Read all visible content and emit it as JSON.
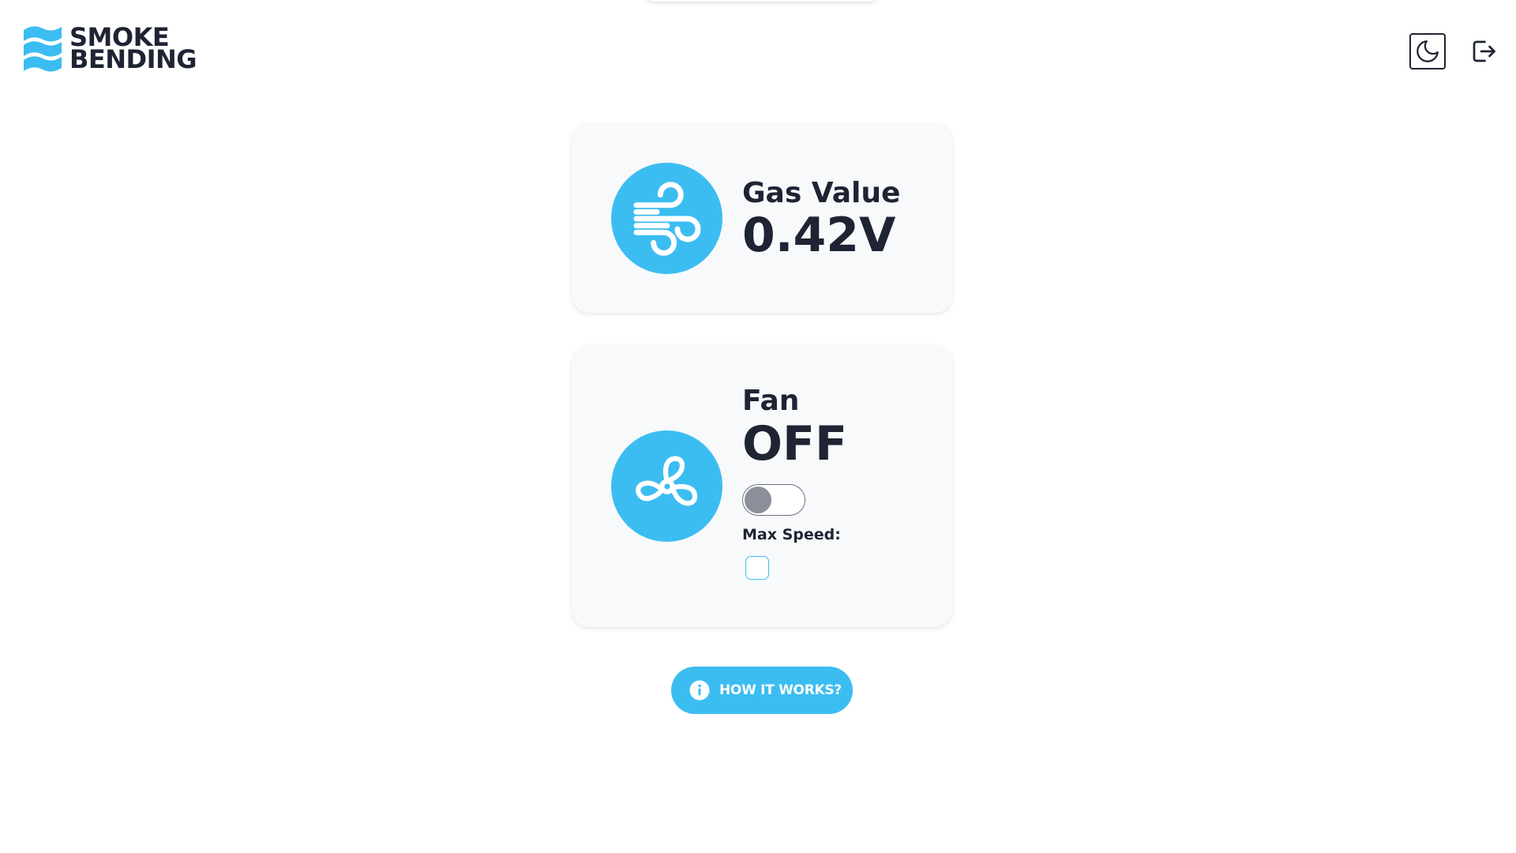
{
  "header": {
    "logo": {
      "line1": "SMOKE",
      "line2": "BENDING",
      "icon": "waves-logo-icon"
    },
    "theme_toggle_icon": "moon-icon",
    "logout_icon": "logout-icon"
  },
  "gas_card": {
    "label": "Gas Value",
    "value": "0.42V",
    "icon": "wind-icon"
  },
  "fan_card": {
    "label": "Fan",
    "status": "OFF",
    "icon": "fan-icon",
    "switch_on": false,
    "max_speed_label": "Max Speed:",
    "max_speed_checked": false
  },
  "help_button": {
    "label": "HOW IT WORKS?",
    "icon": "info-icon"
  },
  "colors": {
    "accent": "#3cbdf1",
    "text": "#1e2433",
    "card_bg": "#f8f9fb",
    "switch_knob_off": "#8a8f99"
  }
}
